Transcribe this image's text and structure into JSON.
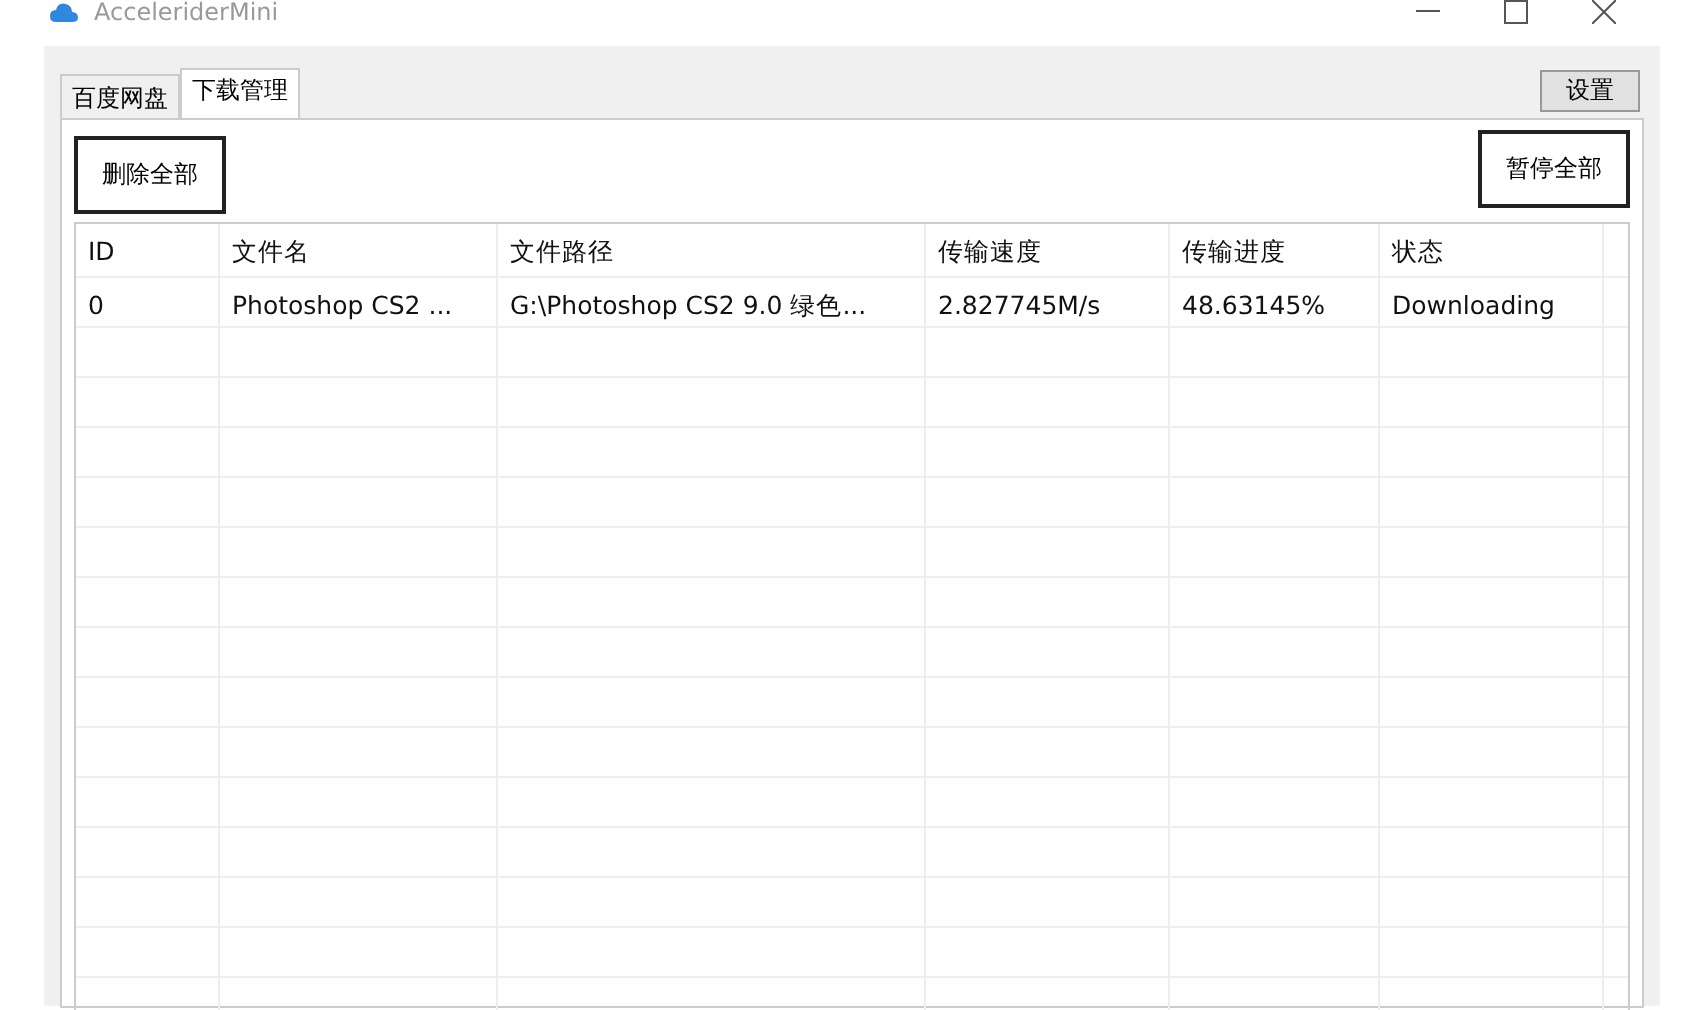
{
  "window": {
    "title": "AcceleriderMini"
  },
  "tabs": [
    {
      "label": "百度网盘",
      "selected": false
    },
    {
      "label": "下载管理",
      "selected": true
    }
  ],
  "settings_button": "设置",
  "buttons": {
    "delete_all": "删除全部",
    "pause_all": "暂停全部"
  },
  "table": {
    "columns": [
      "ID",
      "文件名",
      "文件路径",
      "传输速度",
      "传输进度",
      "状态"
    ],
    "rows": [
      [
        "0",
        "Photoshop CS2 ...",
        "G:\\Photoshop CS2 9.0 绿色...",
        "2.827745M/s",
        "48.63145%",
        "Downloading"
      ]
    ]
  }
}
